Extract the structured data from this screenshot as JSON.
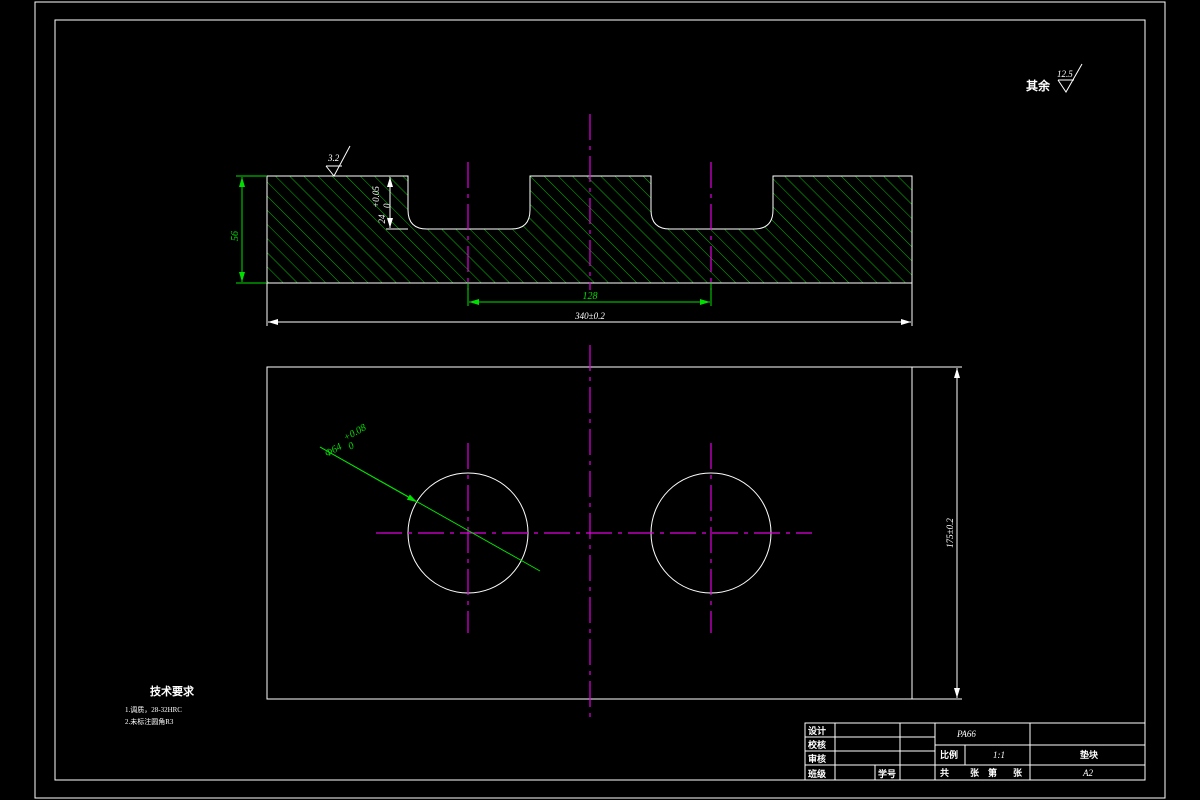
{
  "roughness": {
    "general_label": "其余",
    "general_value": "12.5",
    "top_surface_value": "3.2"
  },
  "dimensions": {
    "height": "56",
    "pocket_depth": "24",
    "pocket_depth_tol_upper": "+0.05",
    "pocket_depth_tol_lower": "0",
    "hole_spacing": "128",
    "length": "340±0.2",
    "width": "175±0.2",
    "hole_dia": "Φ64",
    "hole_dia_tol_upper": "+0.08",
    "hole_dia_tol_lower": "0"
  },
  "notes": {
    "title": "技术要求",
    "items": [
      "1.调质，28-32HRC",
      "2.未标注圆角R3"
    ]
  },
  "title_block": {
    "labels": [
      "设计",
      "校核",
      "审核",
      "班级",
      "学号"
    ],
    "part_name": "PA66",
    "scale_label": "比例",
    "scale_value": "1:1",
    "material": "垫块",
    "sheet_text": [
      "共",
      "张",
      "第",
      "张"
    ],
    "sheet_size": "A2"
  },
  "colors": {
    "background": "#000000",
    "outline": "#ffffff",
    "dimension": "#00e000",
    "centerline": "#e000e0"
  }
}
